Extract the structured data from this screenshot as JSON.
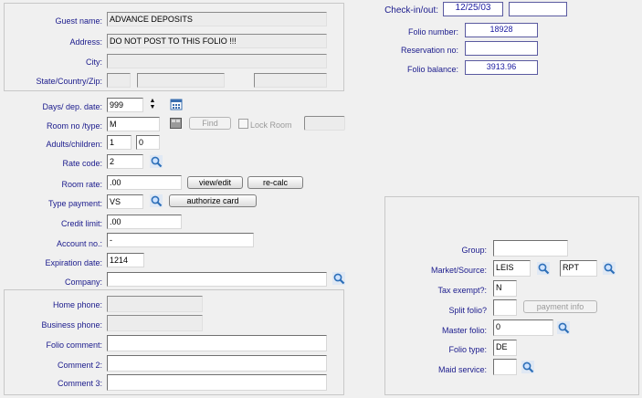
{
  "guest": {
    "name_label": "Guest name:",
    "name_value": "ADVANCE DEPOSITS",
    "address_label": "Address:",
    "address_value": "DO NOT POST TO THIS FOLIO !!!",
    "city_label": "City:",
    "city_value": "",
    "state_label": "State/Country/Zip:",
    "state_value": "",
    "country_value": "",
    "zip_value": ""
  },
  "folio_info": {
    "checkin_label": "Check-in/out:",
    "checkin_value": "12/25/03",
    "checkout_value": "",
    "folio_number_label": "Folio number:",
    "folio_number_value": "18928",
    "reservation_label": "Reservation no:",
    "reservation_value": "",
    "balance_label": "Folio balance:",
    "balance_value": "3913.96"
  },
  "stay": {
    "days_label": "Days/ dep. date:",
    "days_value": "999",
    "room_label": "Room no /type:",
    "room_value": "M",
    "room_type_value": "",
    "find_label": "Find",
    "lock_room_label": "Lock Room",
    "lock_room_value": "",
    "adults_label": "Adults/children:",
    "adults_value": "1",
    "children_value": "0",
    "rate_code_label": "Rate code:",
    "rate_code_value": "2",
    "room_rate_label": "Room rate:",
    "room_rate_value": ".00",
    "view_edit_label": "view/edit",
    "recalc_label": "re-calc",
    "type_payment_label": "Type payment:",
    "type_payment_value": "VS",
    "authorize_label": "authorize card",
    "credit_limit_label": "Credit limit:",
    "credit_limit_value": ".00",
    "account_label": "Account no.:",
    "account_value": "-",
    "expiration_label": "Expiration date:",
    "expiration_value": "1214",
    "company_label": "Company:",
    "company_value": ""
  },
  "contact": {
    "home_phone_label": "Home phone:",
    "home_phone_value": "",
    "business_phone_label": "Business phone:",
    "business_phone_value": "",
    "folio_comment_label": "Folio comment:",
    "folio_comment_value": "",
    "comment2_label": "Comment 2:",
    "comment2_value": "",
    "comment3_label": "Comment 3:",
    "comment3_value": ""
  },
  "group_panel": {
    "group_label": "Group:",
    "group_value": "",
    "market_label": "Market/Source:",
    "market_value": "LEIS",
    "source_value": "RPT",
    "tax_label": "Tax exempt?:",
    "tax_value": "N",
    "split_label": "Split folio?",
    "split_value": "",
    "payment_info_label": "payment info",
    "master_label": "Master folio:",
    "master_value": "0",
    "folio_type_label": "Folio type:",
    "folio_type_value": "DE",
    "maid_label": "Maid service:",
    "maid_value": ""
  },
  "colors": {
    "background": "#f0f0f0",
    "label_text": "#1a1a8c",
    "panel_border": "#c8c8c8",
    "lookup_icon": "#2d6fb8"
  },
  "icons": [
    "calendar-icon",
    "lookup-magnifier-icon",
    "room-grid-icon",
    "spin-arrows-icon"
  ]
}
